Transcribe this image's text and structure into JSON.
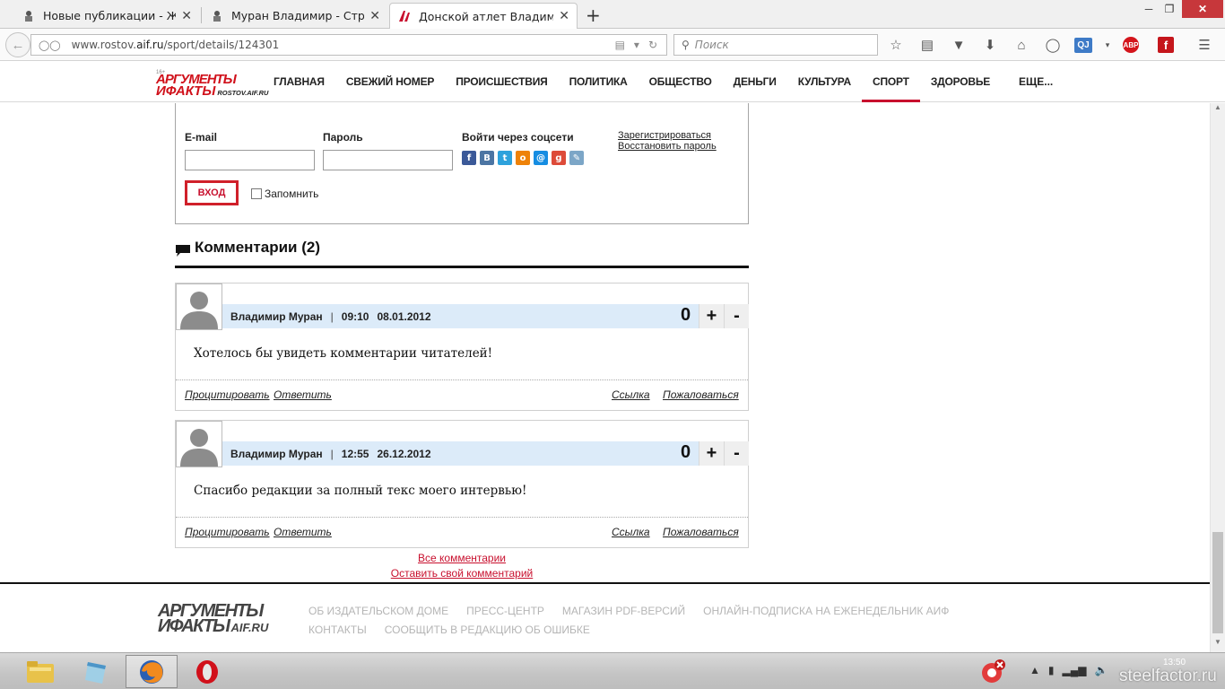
{
  "browser": {
    "tabs": [
      {
        "title": "Новые публикации - ЖЕ...",
        "active": false
      },
      {
        "title": "Муран Владимир - Стра...",
        "active": false
      },
      {
        "title": "Донской атлет Владимир...",
        "active": true
      }
    ],
    "new_tab": "+",
    "close_glyph": "✕",
    "url_host": "www.rostov.",
    "url_domain": "aif.ru",
    "url_path": "/sport/details/124301",
    "search_placeholder": "Поиск",
    "toolbar_icons": [
      "star-icon",
      "reading-list-icon",
      "pocket-icon",
      "download-icon",
      "home-icon",
      "chat-icon",
      "qj-icon",
      "adblock-icon",
      "flash-icon",
      "menu-icon"
    ],
    "qj_label": "QJ",
    "abp_label": "ABP",
    "flash_label": "f"
  },
  "site": {
    "logo_line1": "АРГУМЕНТЫ",
    "logo_line2": "ИФАКТЫ",
    "logo_domain": "ROSTOV.AIF.RU",
    "logo_age": "16+",
    "nav": [
      {
        "label": "ГЛАВНАЯ",
        "active": false
      },
      {
        "label": "СВЕЖИЙ НОМЕР",
        "active": false
      },
      {
        "label": "ПРОИСШЕСТВИЯ",
        "active": false
      },
      {
        "label": "ПОЛИТИКА",
        "active": false
      },
      {
        "label": "ОБЩЕСТВО",
        "active": false
      },
      {
        "label": "ДЕНЬГИ",
        "active": false
      },
      {
        "label": "КУЛЬТУРА",
        "active": false
      },
      {
        "label": "СПОРТ",
        "active": true
      },
      {
        "label": "ЗДОРОВЬЕ",
        "active": false
      }
    ],
    "nav_more": "ЕЩЕ..."
  },
  "login": {
    "email_label": "E-mail",
    "password_label": "Пароль",
    "social_label": "Войти через соцсети",
    "social": [
      {
        "name": "facebook",
        "glyph": "f",
        "color": "#3b5998"
      },
      {
        "name": "vkontakte",
        "glyph": "B",
        "color": "#4c75a3"
      },
      {
        "name": "twitter",
        "glyph": "t",
        "color": "#2ea2dc"
      },
      {
        "name": "odnoklassniki",
        "glyph": "о",
        "color": "#ee8208"
      },
      {
        "name": "mailru",
        "glyph": "@",
        "color": "#168de2"
      },
      {
        "name": "googleplus",
        "glyph": "g",
        "color": "#dd4b39"
      },
      {
        "name": "livejournal",
        "glyph": "✎",
        "color": "#7ca6c7"
      }
    ],
    "register_link": "Зарегистрироваться",
    "restore_link": "Восстановить пароль",
    "submit_label": "ВХОД",
    "remember_label": "Запомнить"
  },
  "comments": {
    "title": "Комментарии (2)",
    "items": [
      {
        "author": "Владимир Муран",
        "separator": "|",
        "time": "09:10",
        "date": "08.01.2012",
        "score": "0",
        "text": "Хотелось бы увидеть комментарии читателей!",
        "quote": "Процитировать",
        "reply": "Ответить",
        "link": "Ссылка",
        "report": "Пожаловаться"
      },
      {
        "author": "Владимир Муран",
        "separator": "|",
        "time": "12:55",
        "date": "26.12.2012",
        "score": "0",
        "text": "Спасибо редакции за полный текс моего интервью!",
        "quote": "Процитировать",
        "reply": "Ответить",
        "link": "Ссылка",
        "report": "Пожаловаться"
      }
    ],
    "plus": "+",
    "minus": "-",
    "all_link": "Все комментарии",
    "leave_link": "Оставить свой комментарий"
  },
  "footer": {
    "logo_line1": "АРГУМЕНТЫ",
    "logo_line2": "ИФАКТЫ",
    "logo_domain": "AIF.RU",
    "links_row1": [
      "ОБ ИЗДАТЕЛЬСКОМ ДОМЕ",
      "ПРЕСС-ЦЕНТР",
      "МАГАЗИН PDF-ВЕРСИЙ",
      "ОНЛАЙН-ПОДПИСКА НА ЕЖЕНЕДЕЛЬНИК АИФ"
    ],
    "links_row2": [
      "КОНТАКТЫ",
      "СООБЩИТЬ В РЕДАКЦИЮ ОБ ОШИБКЕ"
    ]
  },
  "taskbar": {
    "clock": "13:50",
    "watermark": "steelfactor.ru",
    "accent": "#c8102e"
  }
}
